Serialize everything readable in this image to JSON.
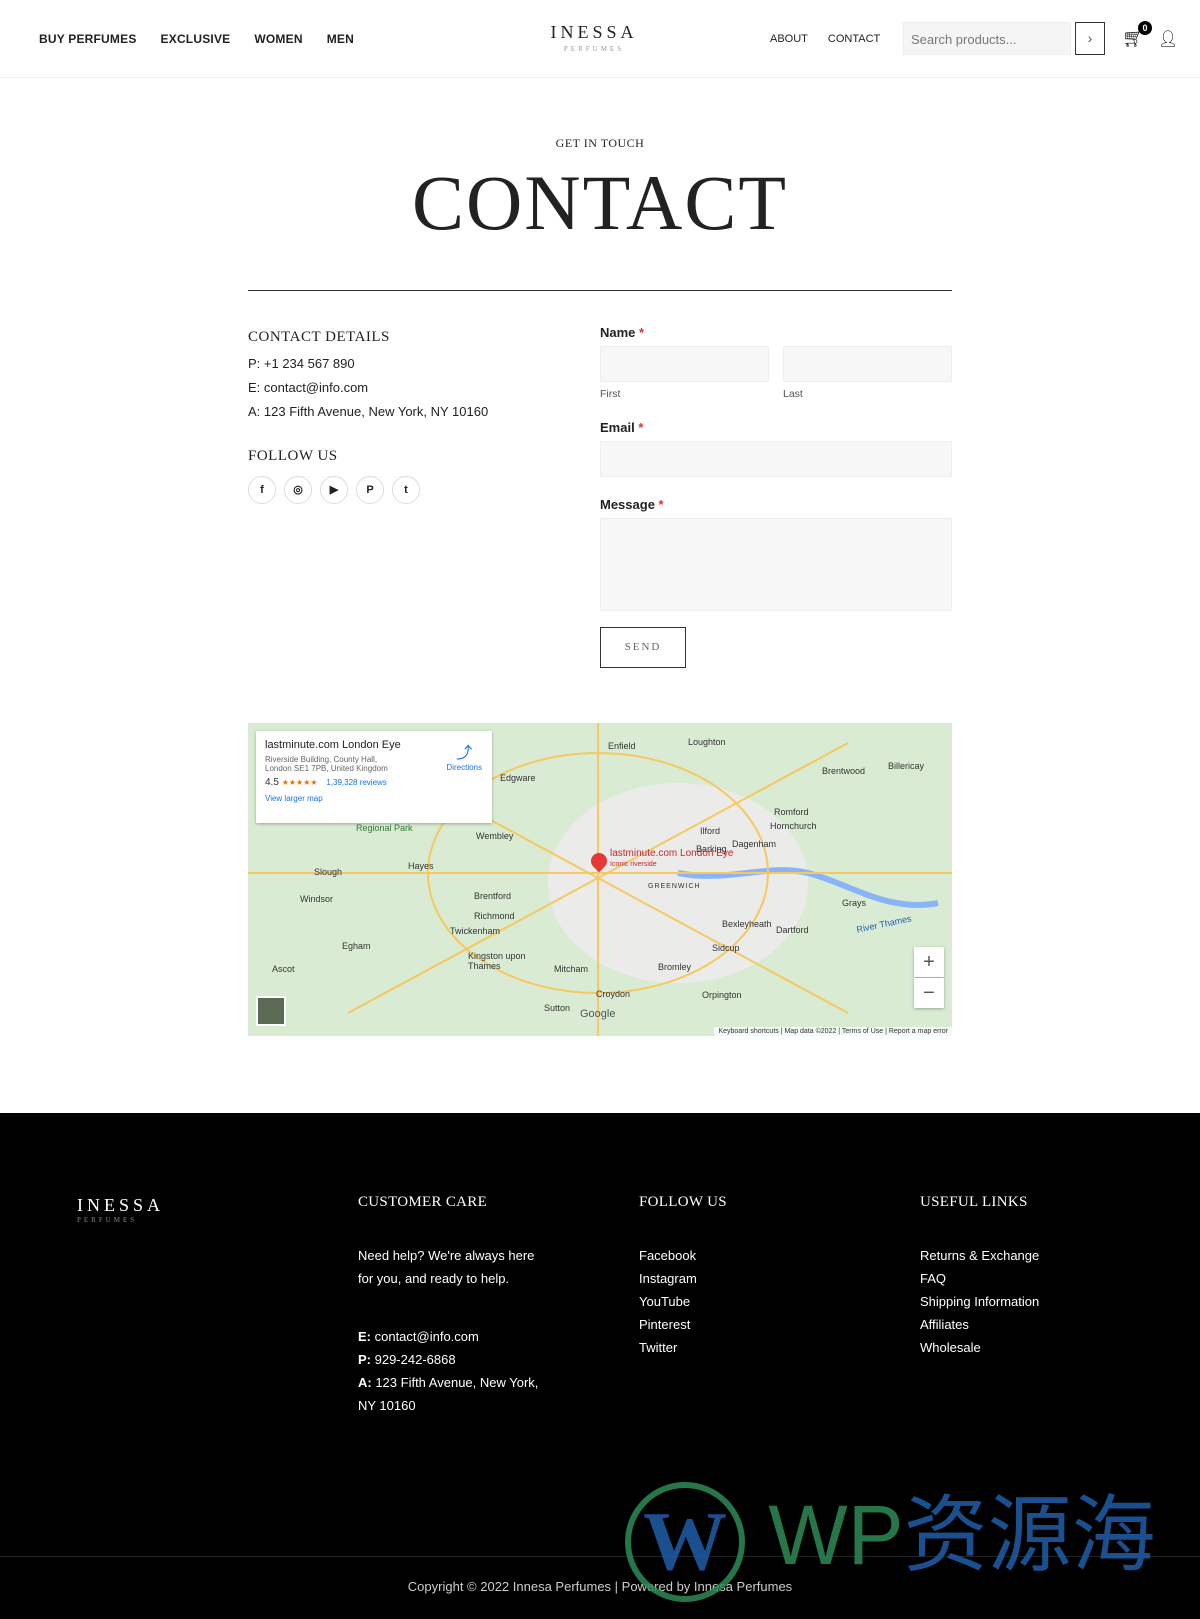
{
  "header": {
    "nav_left": [
      "BUY PERFUMES",
      "EXCLUSIVE",
      "WOMEN",
      "MEN"
    ],
    "logo_name": "INESSA",
    "logo_sub": "PERFUMES",
    "nav_right": [
      "ABOUT",
      "CONTACT"
    ],
    "search_placeholder": "Search products...",
    "cart_count": "0"
  },
  "hero": {
    "eyebrow": "GET IN TOUCH",
    "title": "CONTACT"
  },
  "contact_details": {
    "heading": "CONTACT DETAILS",
    "phone": "P: +1 234 567 890",
    "email": "E: contact@info.com",
    "address": "A: 123 Fifth Avenue, New York, NY 10160",
    "follow_heading": "FOLLOW US",
    "social": [
      "facebook",
      "instagram",
      "youtube",
      "pinterest",
      "twitter"
    ]
  },
  "form": {
    "name_label": "Name",
    "first": "First",
    "last": "Last",
    "email_label": "Email",
    "message_label": "Message",
    "required": "*",
    "send": "SEND"
  },
  "map": {
    "place": "lastminute.com London Eye",
    "address1": "Riverside Building, County Hall,",
    "address2": "London SE1 7PB, United Kingdom",
    "rating": "4.5",
    "stars": "★★★★★",
    "reviews": "1,39,328 reviews",
    "directions": "Directions",
    "larger": "View larger map",
    "pin_label": "lastminute.com London Eye",
    "pin_sub": "Iconic riverside",
    "labels": [
      "Enfield",
      "Loughton",
      "Edgware",
      "Wembley",
      "Ilford",
      "Romford",
      "Hornchurch",
      "Dagenham",
      "Barking",
      "Slough",
      "Hayes",
      "Windsor",
      "Brentford",
      "Richmond",
      "Twickenham",
      "Egham",
      "Kingston upon Thames",
      "Mitcham",
      "Croydon",
      "Bromley",
      "Sidcup",
      "Bexleyheath",
      "Dartford",
      "Orpington",
      "Grays",
      "River Thames",
      "Brentwood",
      "Billericay",
      "GREENWICH",
      "Regional Park",
      "Ascot",
      "Sutton"
    ],
    "zoom_in": "+",
    "zoom_out": "−",
    "footer": "Keyboard shortcuts | Map data ©2022 | Terms of Use | Report a map error",
    "google": "Google"
  },
  "footer": {
    "logo_name": "INESSA",
    "logo_sub": "PERFUMES",
    "care_heading": "CUSTOMER CARE",
    "care_text1": "Need help? We're always here",
    "care_text2": "for you, and ready to help.",
    "email_k": "E:",
    "email": " contact@info.com",
    "phone_k": "P:",
    "phone": " 929-242-6868",
    "addr_k": "A:",
    "addr1": " 123 Fifth Avenue, New York,",
    "addr2": "NY 10160",
    "follow_heading": "FOLLOW US",
    "follow": [
      "Facebook",
      "Instagram",
      "YouTube",
      "Pinterest",
      "Twitter"
    ],
    "links_heading": "USEFUL LINKS",
    "links": [
      "Returns & Exchange",
      "FAQ",
      "Shipping Information",
      "Affiliates",
      "Wholesale"
    ],
    "copyright": "Copyright © 2022 Innesa Perfumes | Powered by Innesa Perfumes"
  },
  "watermark": {
    "wp": "WP",
    "cn": "资源海"
  }
}
